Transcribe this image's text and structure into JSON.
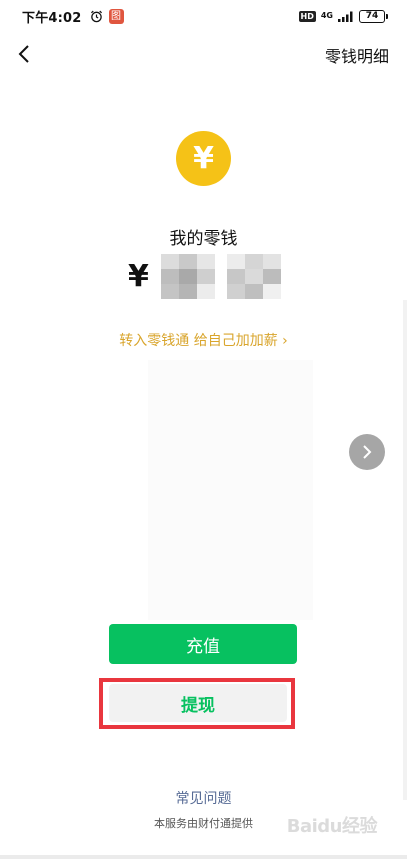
{
  "status_bar": {
    "time": "下午4:02",
    "app_icon_label": "图",
    "hd": "HD",
    "network": "4G",
    "battery": "74"
  },
  "nav": {
    "action_label": "零钱明细"
  },
  "wallet": {
    "coin_symbol": "¥",
    "title": "我的零钱",
    "currency": "¥",
    "promo_link": "转入零钱通 给自己加加薪 ›"
  },
  "actions": {
    "topup_label": "充值",
    "withdraw_label": "提现"
  },
  "footer": {
    "faq": "常见问题",
    "provider": "本服务由财付通提供",
    "watermark": "Baidu经验"
  },
  "colors": {
    "brand_green": "#07c160",
    "coin_yellow": "#f5c217",
    "promo_gold": "#d9a52c",
    "highlight_red": "#e9363e",
    "link_blue": "#576b95"
  }
}
